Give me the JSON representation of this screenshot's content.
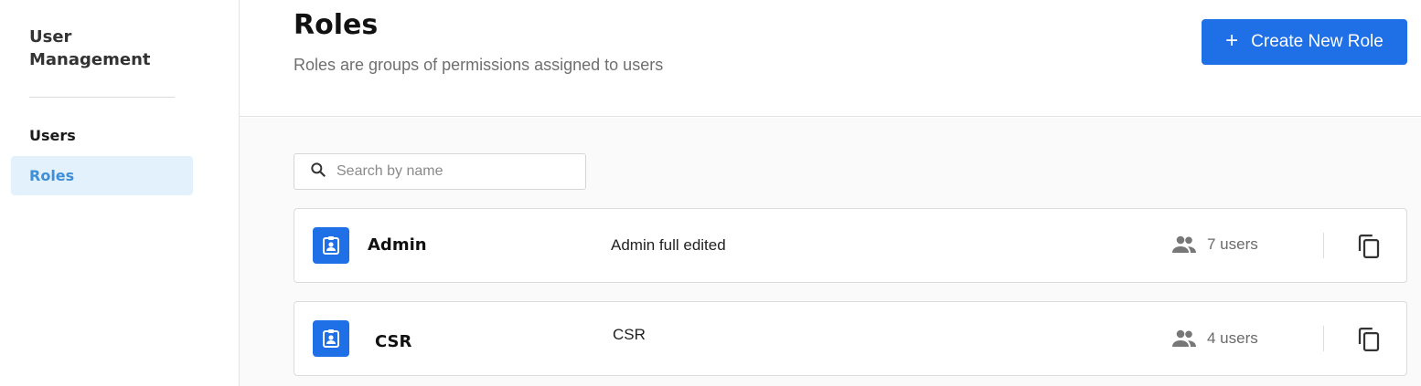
{
  "sidebar": {
    "title": "User Management",
    "items": [
      {
        "label": "Users",
        "active": false
      },
      {
        "label": "Roles",
        "active": true
      }
    ]
  },
  "header": {
    "title": "Roles",
    "subtitle": "Roles are groups of permissions assigned to users",
    "create_button": {
      "icon": "plus-icon",
      "label": "Create New Role"
    }
  },
  "search": {
    "placeholder": "Search by name",
    "value": "",
    "icon": "search-icon"
  },
  "roles": [
    {
      "name": "Admin",
      "description": "Admin full edited",
      "users": "7 users",
      "icon": "badge-icon"
    },
    {
      "name": "CSR",
      "description": "CSR",
      "users": "4 users",
      "icon": "badge-icon"
    }
  ],
  "colors": {
    "accent": "#1f6fe6",
    "active_nav_bg": "#e2f1fc",
    "active_nav_text": "#3e8fd8"
  }
}
